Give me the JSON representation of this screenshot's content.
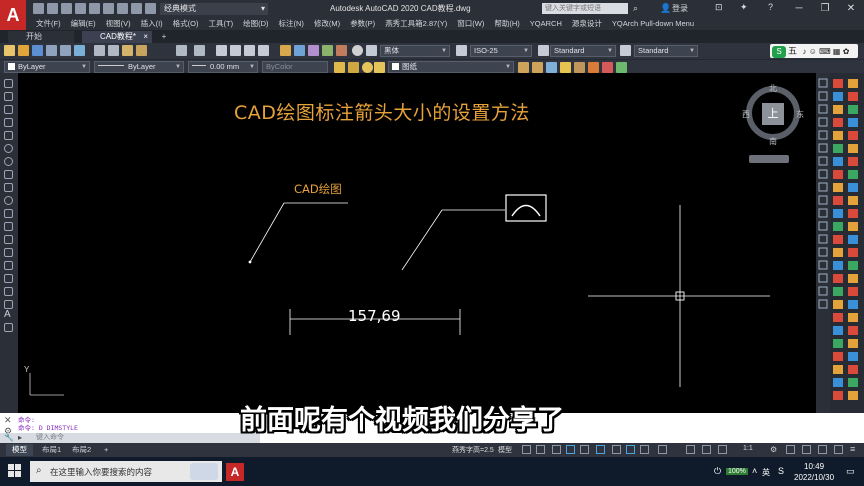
{
  "titlebar": {
    "app_logo": "A",
    "workspace": "经典模式",
    "window_title": "Autodesk AutoCAD 2020    CAD教程.dwg",
    "search_placeholder": "键入关键字或短语",
    "login": "登录"
  },
  "menu": [
    "文件(F)",
    "编辑(E)",
    "视图(V)",
    "插入(I)",
    "格式(O)",
    "工具(T)",
    "绘图(D)",
    "标注(N)",
    "修改(M)",
    "参数(P)",
    "燕秀工具箱2.87(Y)",
    "窗口(W)",
    "帮助(H)",
    "YQARCH",
    "源泉设计",
    "YQArch Pull-down Menu"
  ],
  "tabs": {
    "start": "开始",
    "doc": "CAD教程*",
    "add": "+"
  },
  "toolbar1": {
    "font": "黑体",
    "dim_style": "ISO-25",
    "text_style": "Standard",
    "table_style": "Standard",
    "ime_bar": "五"
  },
  "toolbar2": {
    "color": "ByLayer",
    "linetype": "ByLayer",
    "lineweight": "0.00 mm",
    "plotstyle": "ByColor",
    "layer": "图纸"
  },
  "canvas": {
    "heading": "CAD绘图标注箭头大小的设置方法",
    "leader_label": "CAD绘图",
    "dimension_value": "157,69",
    "ucs_y": "Y"
  },
  "viewcube": {
    "north": "北",
    "south": "南",
    "east": "东",
    "west": "西",
    "top": "上"
  },
  "command": {
    "line1": "命令:",
    "line2": "命令: D DIMSTYLE",
    "placeholder": "键入命令"
  },
  "subtitle": "前面呢有个视频我们分享了",
  "status": {
    "tab_model": "模型",
    "tab_layout1": "布局1",
    "tab_layout2": "布局2",
    "tab_add": "+",
    "scale_label": "燕秀字高=2.5",
    "model_label": "模型",
    "zoom": "1:1"
  },
  "taskbar": {
    "search": "在这里输入你要搜索的内容",
    "battery": "100%",
    "ime": "英",
    "time": "10:49",
    "date": "2022/10/30"
  }
}
